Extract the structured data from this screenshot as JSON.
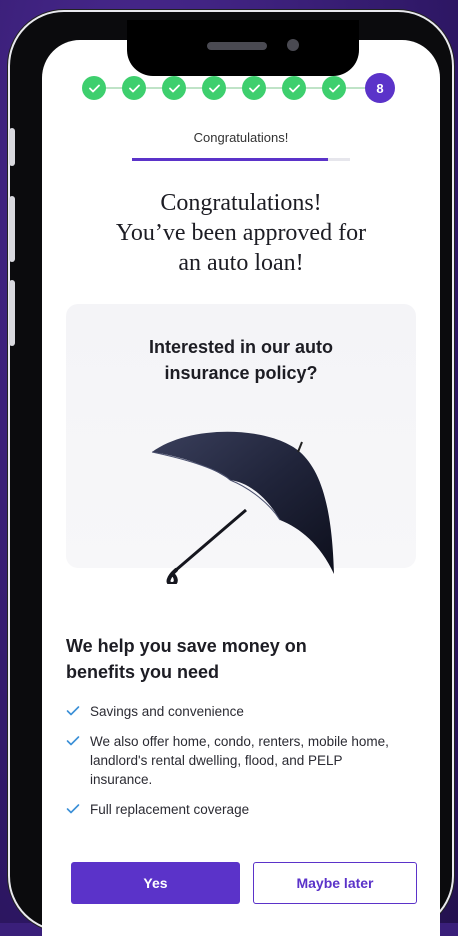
{
  "stepper": {
    "steps": [
      {
        "state": "done",
        "icon": "check-icon"
      },
      {
        "state": "done",
        "icon": "check-icon"
      },
      {
        "state": "done",
        "icon": "check-icon"
      },
      {
        "state": "done",
        "icon": "check-icon"
      },
      {
        "state": "done",
        "icon": "check-icon"
      },
      {
        "state": "done",
        "icon": "check-icon"
      },
      {
        "state": "done",
        "icon": "check-icon"
      },
      {
        "state": "current",
        "label": "8"
      }
    ],
    "progress_label": "Congratulations!",
    "progress_fraction": 0.9
  },
  "headline": {
    "line1": "Congratulations!",
    "line2": "You’ve been approved for",
    "line3": "an auto loan!"
  },
  "insurance_card": {
    "title_line1": "Interested in our auto",
    "title_line2": "insurance policy?",
    "image_icon": "umbrella-icon"
  },
  "benefits": {
    "title_line1": "We help you save money on",
    "title_line2": "benefits you need",
    "items": [
      "Savings and convenience",
      "We also offer home, condo, renters, mobile home, landlord's rental dwelling, flood, and PELP insurance.",
      "Full replacement coverage"
    ]
  },
  "actions": {
    "yes_label": "Yes",
    "later_label": "Maybe later"
  },
  "colors": {
    "accent": "#5b33c9",
    "success": "#3ecf6e",
    "background": "#3a1f7a"
  }
}
